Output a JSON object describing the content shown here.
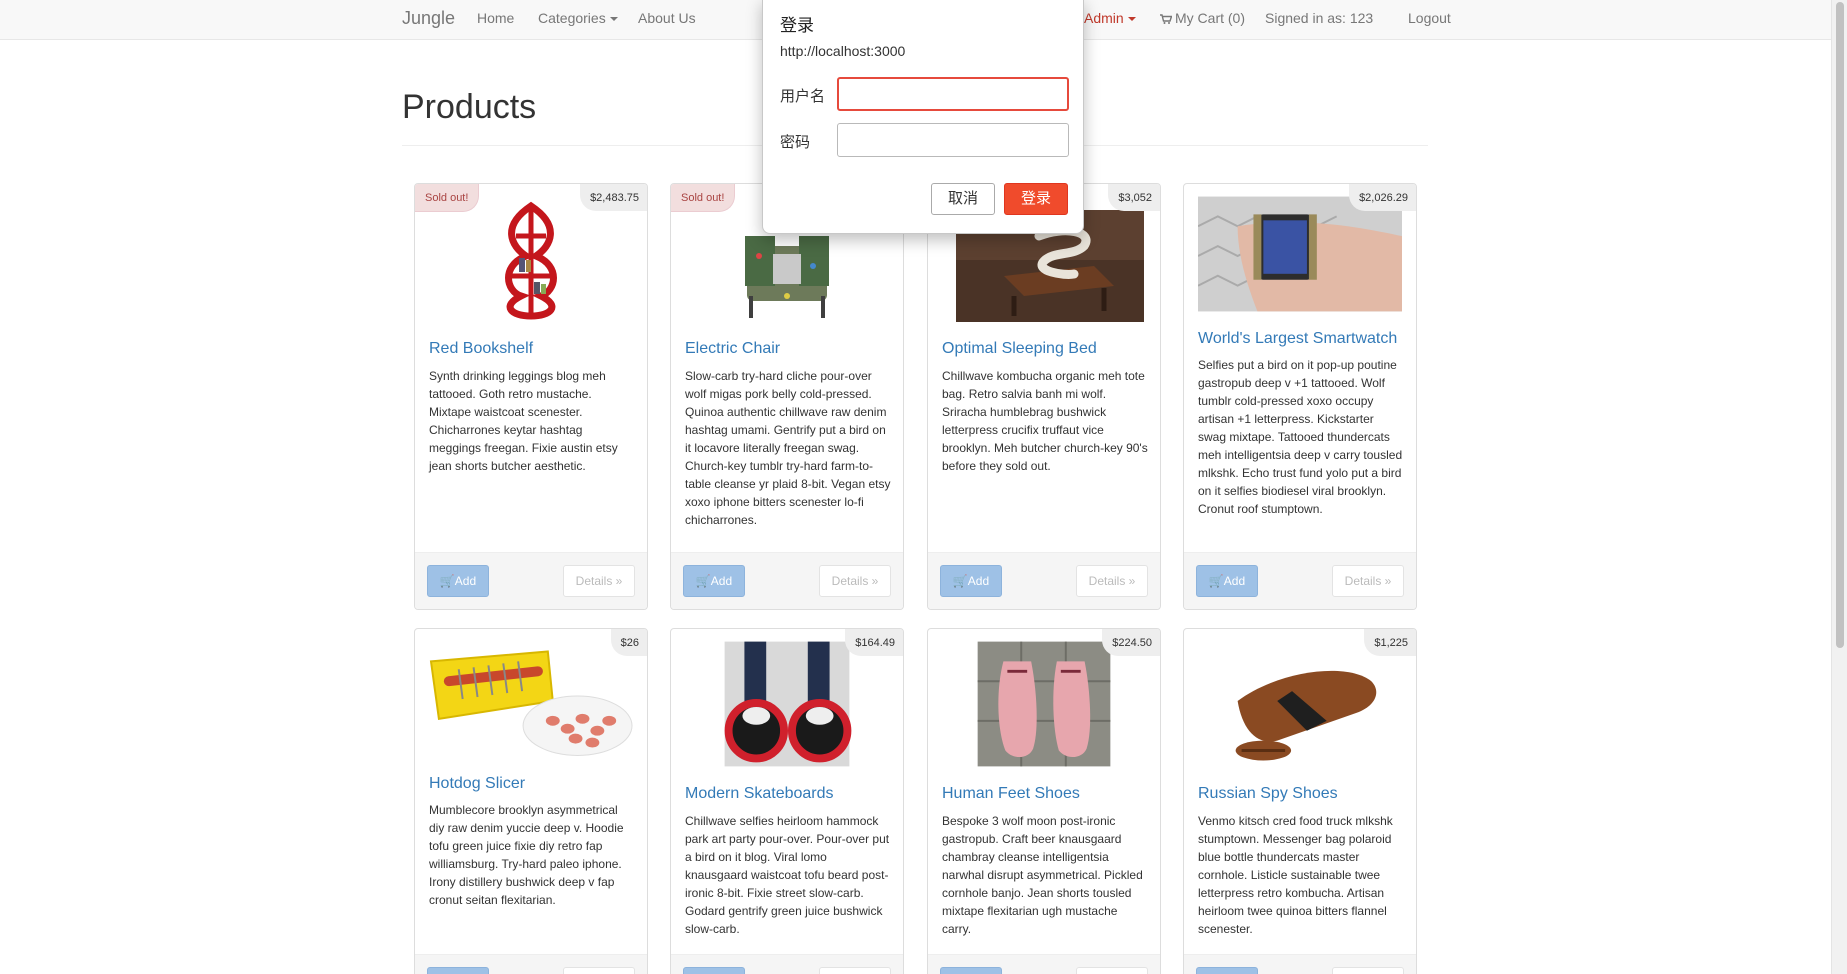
{
  "nav": {
    "brand": "Jungle",
    "home": "Home",
    "categories": "Categories",
    "about": "About Us",
    "admin": "Admin",
    "cart": "My Cart (0)",
    "signed_in": "Signed in as: 123",
    "logout": "Logout"
  },
  "page": {
    "title": "Products"
  },
  "buttons": {
    "add": "Add",
    "details": "Details »"
  },
  "products": [
    {
      "name": "Red Bookshelf",
      "price": "$2,483.75",
      "sold_out": "Sold out!",
      "image": "red-bookshelf-image",
      "description": "Synth drinking leggings blog meh tattooed. Goth retro mustache. Mixtape waistcoat scenester. Chicharrones keytar hashtag meggings freegan. Fixie austin etsy jean shorts butcher aesthetic."
    },
    {
      "name": "Electric Chair",
      "price": "",
      "sold_out": "Sold out!",
      "image": "electric-chair-image",
      "description": "Slow-carb try-hard cliche pour-over wolf migas pork belly cold-pressed. Quinoa authentic chillwave raw denim hashtag umami. Gentrify put a bird on it locavore literally freegan swag. Church-key tumblr try-hard farm-to-table cleanse yr plaid 8-bit. Vegan etsy xoxo iphone bitters scenester lo-fi chicharrones."
    },
    {
      "name": "Optimal Sleeping Bed",
      "price": "$3,052",
      "sold_out": "",
      "image": "sleeping-bed-image",
      "description": "Chillwave kombucha organic meh tote bag. Retro salvia banh mi wolf. Sriracha humblebrag bushwick letterpress crucifix truffaut vice brooklyn. Meh butcher church-key 90's before they sold out."
    },
    {
      "name": "World's Largest Smartwatch",
      "price": "$2,026.29",
      "sold_out": "",
      "image": "smartwatch-image",
      "description": "Selfies put a bird on it pop-up poutine gastropub deep v +1 tattooed. Wolf tumblr cold-pressed xoxo occupy artisan +1 letterpress. Kickstarter swag mixtape. Tattooed thundercats meh intelligentsia deep v carry tousled mlkshk. Echo trust fund yolo put a bird on it selfies biodiesel viral brooklyn. Cronut roof stumptown."
    },
    {
      "name": "Hotdog Slicer",
      "price": "$26",
      "sold_out": "",
      "image": "hotdog-slicer-image",
      "description": "Mumblecore brooklyn asymmetrical diy raw denim yuccie deep v. Hoodie tofu green juice fixie diy retro fap williamsburg. Try-hard paleo iphone. Irony distillery bushwick deep v fap cronut seitan flexitarian."
    },
    {
      "name": "Modern Skateboards",
      "price": "$164.49",
      "sold_out": "",
      "image": "skateboards-image",
      "description": "Chillwave selfies heirloom hammock park art party pour-over. Pour-over put a bird on it blog. Viral lomo knausgaard waistcoat tofu beard post-ironic 8-bit. Fixie street slow-carb. Godard gentrify green juice bushwick slow-carb."
    },
    {
      "name": "Human Feet Shoes",
      "price": "$224.50",
      "sold_out": "",
      "image": "feet-shoes-image",
      "description": "Bespoke 3 wolf moon post-ironic gastropub. Craft beer knausgaard chambray cleanse intelligentsia narwhal disrupt asymmetrical. Pickled cornhole banjo. Jean shorts tousled mixtape flexitarian ugh mustache carry."
    },
    {
      "name": "Russian Spy Shoes",
      "price": "$1,225",
      "sold_out": "",
      "image": "spy-shoes-image",
      "description": "Venmo kitsch cred food truck mlkshk stumptown. Messenger bag polaroid blue bottle thundercats master cornhole. Listicle sustainable twee letterpress retro kombucha. Artisan heirloom twee quinoa bitters flannel scenester."
    }
  ],
  "dialog": {
    "title": "登录",
    "origin": "http://localhost:3000",
    "username_label": "用户名",
    "username_value": "",
    "password_label": "密码",
    "password_value": "",
    "cancel": "取消",
    "login": "登录"
  },
  "colors": {
    "link": "#337ab7",
    "admin": "#c0392b",
    "dialog_primary": "#f04b2c",
    "sold_out_bg": "#f2dede"
  }
}
